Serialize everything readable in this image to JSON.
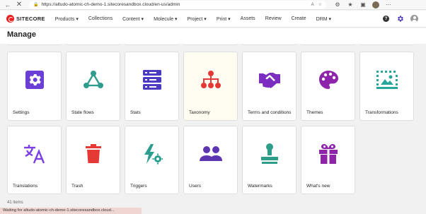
{
  "browser": {
    "url": "https://altudo-atomic-ch-demo-1.sitecoresandbox.cloud/en-us/admin",
    "reader_label": "A"
  },
  "header": {
    "brand": "SITECORE",
    "nav": [
      "Products ▾",
      "Collections",
      "Content ▾",
      "Molecule ▾",
      "Project ▾",
      "Print ▾",
      "Assets",
      "Review",
      "Create",
      "DRM ▾"
    ]
  },
  "page": {
    "title": "Manage"
  },
  "tiles": [
    {
      "label": "Settings",
      "icon": "gear-icon",
      "color": "#6b3fd6"
    },
    {
      "label": "State flows",
      "icon": "state-flow-icon",
      "color": "#2f9c8e"
    },
    {
      "label": "Stats",
      "icon": "server-stack-icon",
      "color": "#4a3bc2"
    },
    {
      "label": "Taxonomy",
      "icon": "hierarchy-icon",
      "color": "#e53935"
    },
    {
      "label": "Terms and conditions",
      "icon": "handshake-icon",
      "color": "#7b2ebf"
    },
    {
      "label": "Themes",
      "icon": "palette-icon",
      "color": "#8e24aa"
    },
    {
      "label": "Transformations",
      "icon": "image-transform-icon",
      "color": "#26a69a"
    },
    {
      "label": "Translations",
      "icon": "translate-icon",
      "color": "#7b3fe4"
    },
    {
      "label": "Trash",
      "icon": "trash-icon",
      "color": "#e53935"
    },
    {
      "label": "Triggers",
      "icon": "trigger-icon",
      "color": "#2a9d8f"
    },
    {
      "label": "Users",
      "icon": "users-icon",
      "color": "#5e35b1"
    },
    {
      "label": "Watermarks",
      "icon": "stamp-icon",
      "color": "#2e9d8a"
    },
    {
      "label": "What's new",
      "icon": "gift-icon",
      "color": "#8e24aa"
    }
  ],
  "footer": {
    "items_count": "41 items",
    "status": "Waiting for altudo-atomic-ch-demo-1.sitecoresandbox.cloud..."
  }
}
